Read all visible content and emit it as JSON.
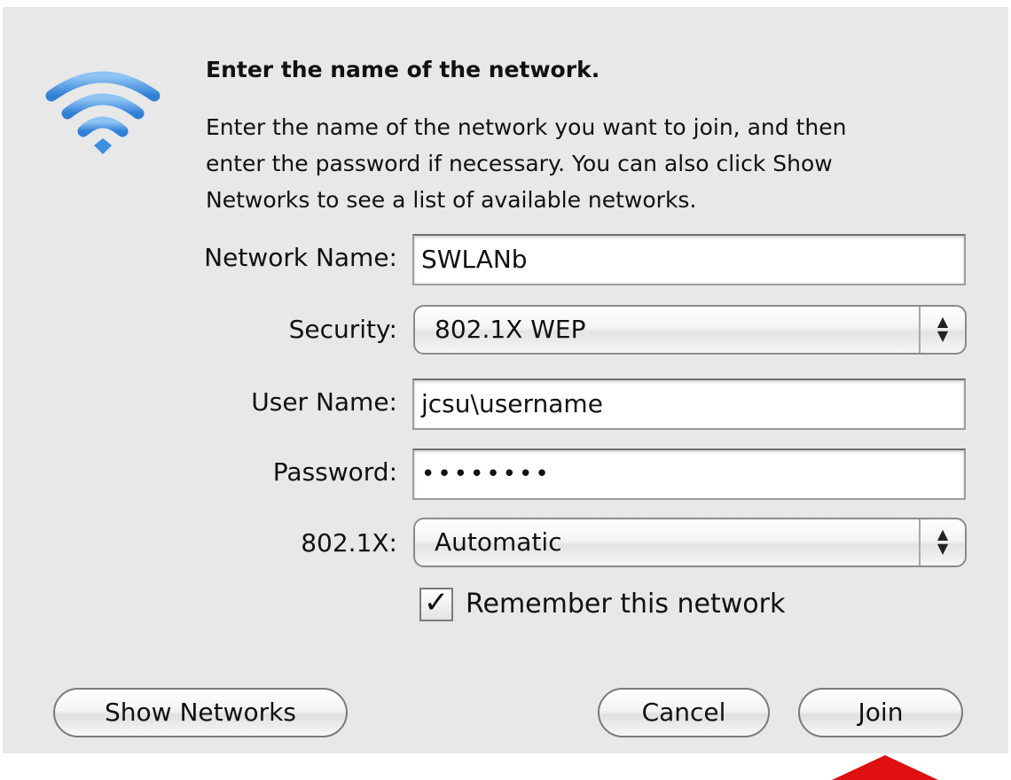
{
  "dialog": {
    "heading": "Enter the name of the network.",
    "description": [
      "Enter the name of the network you want to join, and then",
      "enter the password if necessary. You can also click Show",
      "Networks to see a list of available networks."
    ],
    "icon": "wifi-icon"
  },
  "form": {
    "network_name_label": "Network Name:",
    "network_name_value": "SWLANb",
    "security_label": "Security:",
    "security_value": "802.1X WEP",
    "user_name_label": "User Name:",
    "user_name_value": "jcsu\\username",
    "password_label": "Password:",
    "password_value": "••••••••",
    "eap_label": "802.1X:",
    "eap_value": "Automatic",
    "remember_label": "Remember this network",
    "remember_checked": true
  },
  "buttons": {
    "show_networks": "Show Networks",
    "cancel": "Cancel",
    "join": "Join"
  },
  "colors": {
    "wifi_blue": "#3d8fe0",
    "highlight_arrow": "#e01010",
    "dialog_background": "#e8e8e8"
  }
}
